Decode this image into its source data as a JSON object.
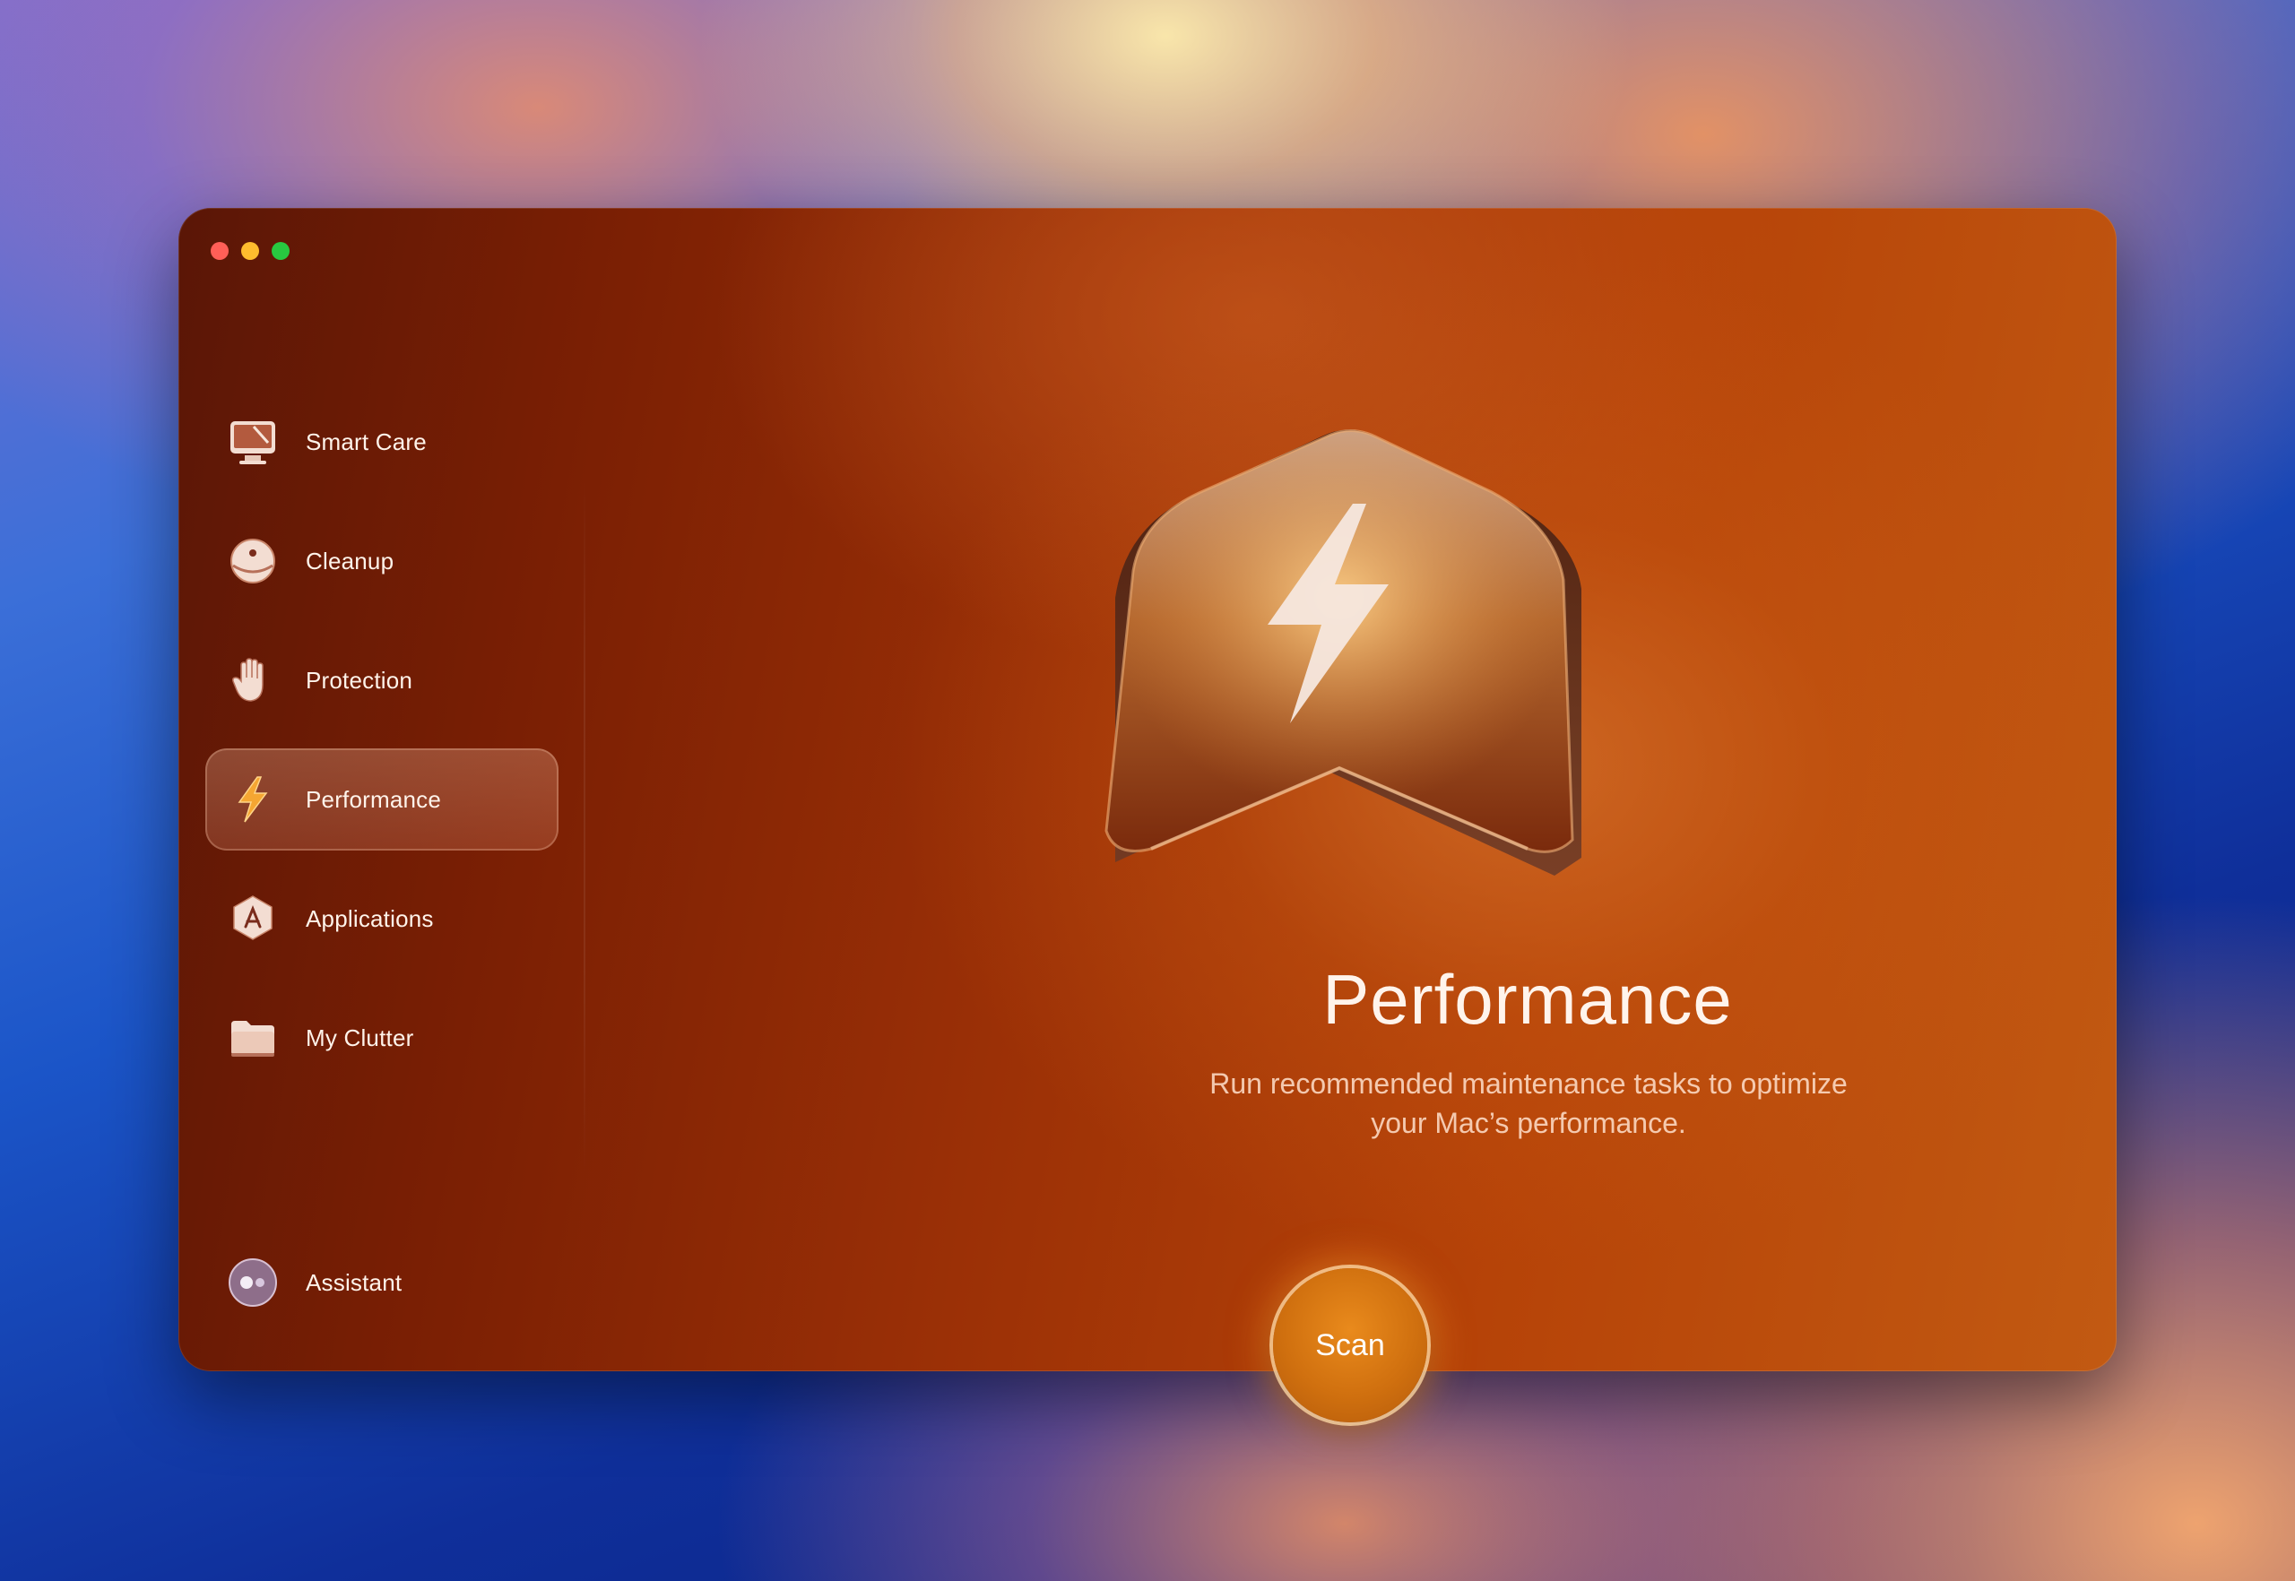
{
  "sidebar": {
    "items": [
      {
        "label": "Smart Care",
        "icon": "imac-icon"
      },
      {
        "label": "Cleanup",
        "icon": "disc-icon"
      },
      {
        "label": "Protection",
        "icon": "hand-icon"
      },
      {
        "label": "Performance",
        "icon": "bolt-icon",
        "active": true
      },
      {
        "label": "Applications",
        "icon": "app-badge-icon"
      },
      {
        "label": "My Clutter",
        "icon": "folder-icon"
      }
    ],
    "assistant": {
      "label": "Assistant",
      "icon": "assistant-orb-icon"
    }
  },
  "main": {
    "title": "Performance",
    "subtitle_line1": "Run recommended maintenance tasks to optimize",
    "subtitle_line2": "your Mac’s performance.",
    "scan_label": "Scan"
  },
  "colors": {
    "accent": "#d0700f",
    "window_dark": "#5a1606",
    "window_light": "#c25a12"
  }
}
